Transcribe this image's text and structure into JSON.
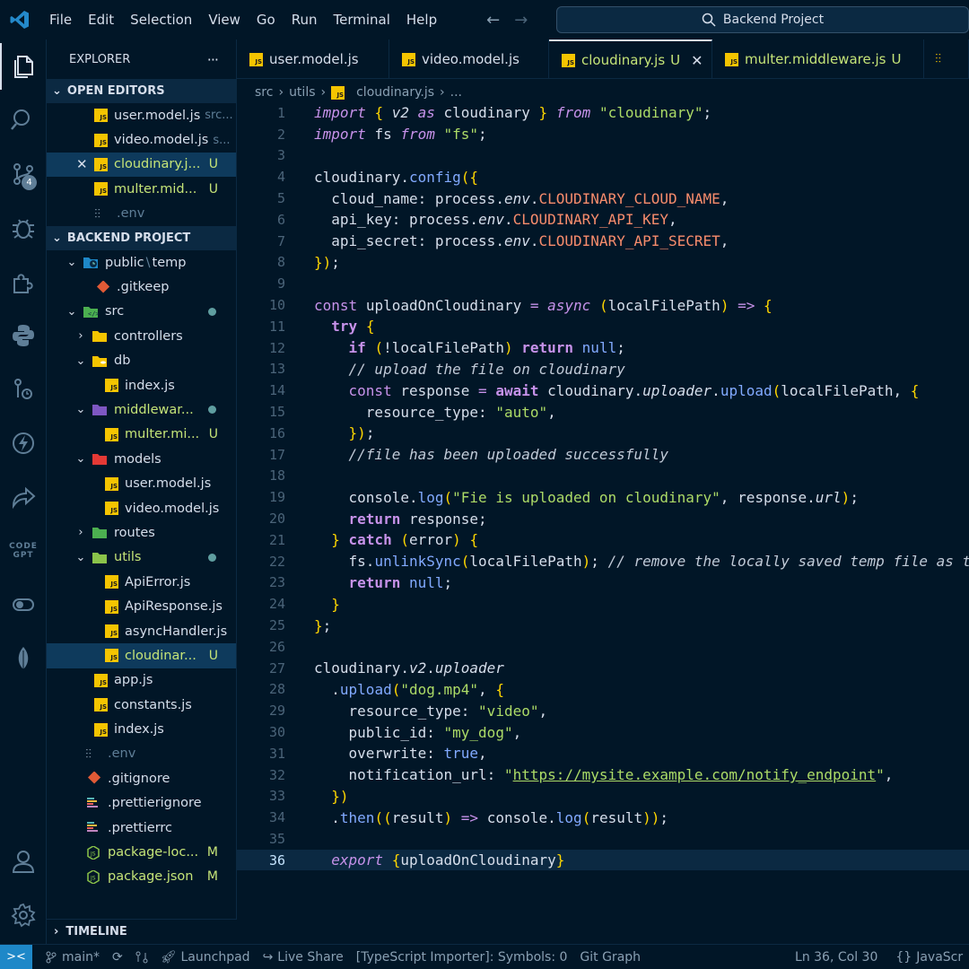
{
  "menu": [
    "File",
    "Edit",
    "Selection",
    "View",
    "Go",
    "Run",
    "Terminal",
    "Help"
  ],
  "search": {
    "label": "Backend Project"
  },
  "activity": {
    "scm_badge": "4",
    "codegpt_top": "CODE",
    "codegpt_bottom": "GPT"
  },
  "explorer": {
    "title": "EXPLORER",
    "more": "···",
    "open_editors_title": "OPEN EDITORS",
    "open_editors": [
      {
        "name": "user.model.js",
        "hint": "src...",
        "status": ""
      },
      {
        "name": "video.model.js",
        "hint": "s...",
        "status": ""
      },
      {
        "name": "cloudinary.j...",
        "hint": "",
        "status": "U"
      },
      {
        "name": "multer.mid...",
        "hint": "",
        "status": "U"
      },
      {
        "name": ".env",
        "hint": "",
        "status": ""
      }
    ],
    "project_title": "BACKEND PROJECT",
    "tree": {
      "public": "public",
      "public_sep": "\\",
      "temp": "temp",
      "gitkeep": ".gitkeep",
      "src": "src",
      "controllers": "controllers",
      "db": "db",
      "db_index": "index.js",
      "middlewares": "middlewar...",
      "multer": "multer.mi...",
      "multer_status": "U",
      "models": "models",
      "user_model": "user.model.js",
      "video_model": "video.model.js",
      "routes": "routes",
      "utils": "utils",
      "api_error": "ApiError.js",
      "api_response": "ApiResponse.js",
      "async_handler": "asyncHandler.js",
      "cloudinary": "cloudinar...",
      "cloudinary_status": "U",
      "app": "app.js",
      "constants": "constants.js",
      "index": "index.js",
      "env": ".env",
      "gitignore": ".gitignore",
      "prettierignore": ".prettierignore",
      "prettierrc": ".prettierrc",
      "package_lock": "package-loc...",
      "package_lock_status": "M",
      "package_json": "package.json",
      "package_json_status": "M"
    },
    "timeline": "TIMELINE"
  },
  "tabs": [
    {
      "name": "user.model.js",
      "status": ""
    },
    {
      "name": "video.model.js",
      "status": ""
    },
    {
      "name": "cloudinary.js",
      "status": "U"
    },
    {
      "name": "multer.middleware.js",
      "status": "U"
    }
  ],
  "breadcrumb": {
    "part1": "src",
    "part2": "utils",
    "part3": "cloudinary.js",
    "part4": "..."
  },
  "editor": {
    "line_numbers": [
      "1",
      "2",
      "3",
      "4",
      "5",
      "6",
      "7",
      "8",
      "9",
      "10",
      "11",
      "12",
      "13",
      "14",
      "15",
      "16",
      "17",
      "18",
      "19",
      "20",
      "21",
      "22",
      "23",
      "24",
      "25",
      "26",
      "27",
      "28",
      "29",
      "30",
      "31",
      "32",
      "33",
      "34",
      "35",
      "36"
    ],
    "lines": [
      "import { v2 as cloudinary } from \"cloudinary\";",
      "import fs from \"fs\";",
      "",
      "cloudinary.config({",
      "  cloud_name: process.env.CLOUDINARY_CLOUD_NAME,",
      "  api_key: process.env.CLOUDINARY_API_KEY,",
      "  api_secret: process.env.CLOUDINARY_API_SECRET,",
      "});",
      "",
      "const uploadOnCloudinary = async (localFilePath) => {",
      "  try {",
      "    if (!localFilePath) return null;",
      "    // upload the file on cloudinary",
      "    const response = await cloudinary.uploader.upload(localFilePath, {",
      "      resource_type: \"auto\",",
      "    });",
      "    //file has been uploaded successfully",
      "",
      "    console.log(\"Fie is uploaded on cloudinary\", response.url);",
      "    return response;",
      "  } catch (error) {",
      "    fs.unlinkSync(localFilePath); // remove the locally saved temp file as t",
      "    return null;",
      "  }",
      "};",
      "",
      "cloudinary.v2.uploader",
      "  .upload(\"dog.mp4\", {",
      "    resource_type: \"video\",",
      "    public_id: \"my_dog\",",
      "    overwrite: true,",
      "    notification_url: \"https://mysite.example.com/notify_endpoint\",",
      "  })",
      "  .then((result) => console.log(result));",
      "",
      "  export {uploadOnCloudinary}"
    ]
  },
  "status": {
    "branch": "main*",
    "launchpad": "Launchpad",
    "live_share": "Live Share",
    "ts_importer": "[TypeScript Importer]: Symbols: 0",
    "git_graph": "Git Graph",
    "position": "Ln 36, Col 30",
    "language": "JavaScr"
  }
}
